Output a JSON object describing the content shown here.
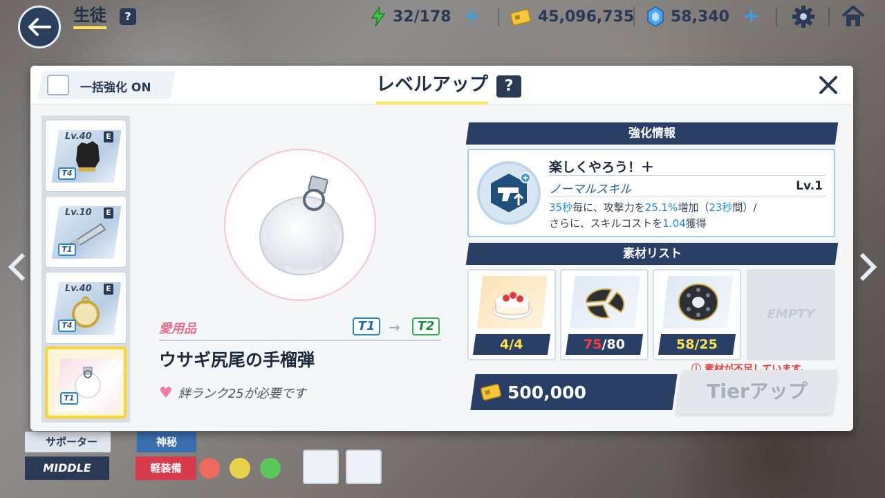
{
  "topbar": {
    "title": "生徒",
    "help": "?",
    "ap": "32/178",
    "credits": "45,096,735",
    "gems": "58,340"
  },
  "dialog": {
    "title": "レベルアップ",
    "help": "?",
    "bulk_label": "一括強化 ON"
  },
  "items": [
    {
      "level": "Lv.40",
      "badge": "E",
      "tier": "T4"
    },
    {
      "level": "Lv.10",
      "badge": "E",
      "tier": "T1"
    },
    {
      "level": "Lv.40",
      "badge": "E",
      "tier": "T4"
    },
    {
      "level": "",
      "badge": "",
      "tier": "T1"
    }
  ],
  "selected_item": {
    "category": "愛用品",
    "tier_from": "T1",
    "tier_to": "T2",
    "name": "ウサギ尻尾の手榴弾",
    "bond_requirement": "絆ランク25が必要です"
  },
  "enhance_info": {
    "header": "強化情報",
    "skill_name": "楽しくやろう！＋",
    "skill_type": "ノーマルスキル",
    "skill_level": "Lv.1",
    "desc_1": "35秒",
    "desc_2": "毎に、攻撃力を",
    "desc_3": "25.1%",
    "desc_4": "増加（",
    "desc_5": "23秒",
    "desc_6": "間）/",
    "desc_7": "さらに、スキルコストを",
    "desc_8": "1.04",
    "desc_9": "獲得"
  },
  "materials": {
    "header": "素材リスト",
    "items": [
      {
        "have": "4",
        "sep": "/",
        "need": "4"
      },
      {
        "have": "75",
        "sep": "/",
        "need": "80"
      },
      {
        "have": "58",
        "sep": "/",
        "need": "25"
      }
    ],
    "empty_label": "EMPTY",
    "warning": "素材が不足しています。"
  },
  "cost": "500,000",
  "tier_up_label": "Tierアップ",
  "background_ui": {
    "supporter": "サポーター",
    "mystic": "神秘",
    "middle": "MIDDLE",
    "armor": "軽装備"
  },
  "colors": {
    "accent_yellow": "#ffe15a",
    "navy": "#2a3f66",
    "warning_red": "#e63b3b",
    "highlight_blue": "#1f8ae0"
  }
}
